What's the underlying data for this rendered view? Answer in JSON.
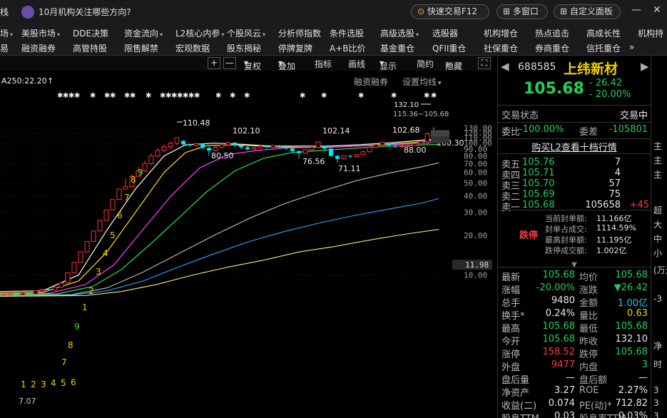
{
  "topbar": {
    "left_fragment": "栈",
    "news": "10月机构关注哪些方向?",
    "quick_trade": "快速交易F12",
    "multi_window": "多窗口",
    "custom_panel": "自定义面板",
    "minimize": "—",
    "close": "✕"
  },
  "menu_row1": [
    "场",
    "美股市场",
    "DDE决策",
    "资金流向",
    "L2核心内参",
    "个股风云",
    "分析师指数",
    "条件选股",
    "高级选股",
    "选股器",
    "机构增仓",
    "热点追击",
    "高成长性",
    "机构持"
  ],
  "menu_row2": [
    "易",
    "融资融券",
    "高管持股",
    "限售解禁",
    "宏观数据",
    "股东揭秘",
    "停牌复牌",
    "A+B比价",
    "基金重仓",
    "QFII重仓",
    "社保重仓",
    "券商重仓",
    "信托重仓",
    "»"
  ],
  "chart_toolbar": {
    "plus": "+",
    "minus": "—",
    "restore": "复权",
    "overlay": "叠加",
    "indicator": "指标",
    "draw": "画线",
    "display": "显示",
    "simple": "简约",
    "hide": "隐藏",
    "expand": "»"
  },
  "chart": {
    "ma_label": "A250:22.20",
    "margin_label": "融资融券",
    "set_ma": "设置均线",
    "y_ticks": [
      "130.00",
      "120.00",
      "110.00",
      "100.00",
      "90.00",
      "80.00",
      "70.00",
      "60.00",
      "50.00",
      "40.00",
      "30.00",
      "20.00",
      "10.00"
    ],
    "y_highlight": "11.98",
    "annotations": {
      "high": "132.10",
      "range": "115.36~105.68",
      "p110": "110.48",
      "p102a": "102.10",
      "p102b": "102.14",
      "p102c": "102.68",
      "p80": "80.50",
      "p76": "76.56",
      "p71": "71.11",
      "p88": "88.00",
      "p100": "100.30",
      "p7": "7.07"
    },
    "seq_a": [
      "1",
      "2",
      "3",
      "4",
      "5",
      "6"
    ],
    "seq_b": [
      "7",
      "8",
      "9",
      "1",
      "2",
      "3",
      "4",
      "5",
      "6",
      "7",
      "8",
      "9"
    ]
  },
  "stock": {
    "code": "688585",
    "name": "上纬新材",
    "price": "105.68",
    "change": "- 26.42",
    "pct": "- 20.00%",
    "status_label": "交易状态",
    "status_value": "交易中",
    "wb_label": "委比",
    "wb_value": "-100.00%",
    "wc_label": "委差",
    "wc_value": "-105801",
    "l2_link": "购买L2查看十档行情"
  },
  "asks": [
    {
      "label": "卖五",
      "price": "105.76",
      "vol": "7"
    },
    {
      "label": "卖四",
      "price": "105.71",
      "vol": "4"
    },
    {
      "label": "卖三",
      "price": "105.70",
      "vol": "57"
    },
    {
      "label": "卖二",
      "price": "105.69",
      "vol": "75"
    },
    {
      "label": "卖一",
      "price": "105.68",
      "vol": "105658",
      "delta": "+45"
    }
  ],
  "limit_down": {
    "tag": "跌停",
    "rows": [
      {
        "label": "当前封单额:",
        "value": "11.166亿"
      },
      {
        "label": "封单占成交:",
        "value": "1114.59%"
      },
      {
        "label": "最高封单额:",
        "value": "11.195亿"
      },
      {
        "label": "跌停成交额:",
        "value": "1.002亿"
      }
    ]
  },
  "stats": [
    {
      "l1": "最新",
      "v1": "105.68",
      "c1": "green",
      "l2": "均价",
      "v2": "105.68",
      "c2": "green"
    },
    {
      "l1": "涨幅",
      "v1": "-20.00%",
      "c1": "green",
      "l2": "涨跌",
      "v2": "▼26.42",
      "c2": "green"
    },
    {
      "l1": "总手",
      "v1": "9480",
      "c1": "white",
      "l2": "金额",
      "v2": "1.00亿",
      "c2": "cyan"
    },
    {
      "l1": "换手*",
      "v1": "0.24%",
      "c1": "white",
      "l2": "量比",
      "v2": "0.63",
      "c2": "yellow"
    },
    {
      "l1": "最高",
      "v1": "105.68",
      "c1": "green",
      "l2": "最低",
      "v2": "105.68",
      "c2": "green"
    },
    {
      "l1": "今开",
      "v1": "105.68",
      "c1": "green",
      "l2": "昨收",
      "v2": "132.10",
      "c2": "white"
    },
    {
      "l1": "涨停",
      "v1": "158.52",
      "c1": "red",
      "l2": "跌停",
      "v2": "105.68",
      "c2": "green"
    },
    {
      "l1": "外盘",
      "v1": "9477",
      "c1": "red",
      "l2": "内盘",
      "v2": "3",
      "c2": "green"
    },
    {
      "l1": "盘后量",
      "v1": "—",
      "c1": "white",
      "l2": "盘后额",
      "v2": "—",
      "c2": "white"
    },
    {
      "l1": "净资产",
      "v1": "3.27",
      "c1": "white",
      "l2": "ROE",
      "v2": "2.27%",
      "c2": "white"
    },
    {
      "l1": "收益(二)",
      "v1": "0.074",
      "c1": "white",
      "l2": "PE(动)*",
      "v2": "712.82",
      "c2": "white"
    },
    {
      "l1": "股息TTM",
      "v1": "0.03",
      "c1": "white",
      "l2": "股息率TTM",
      "v2": "0.03%",
      "c2": "white"
    }
  ],
  "far_panel": [
    "主",
    "主",
    "主",
    "超",
    "大",
    "中",
    "小",
    "(万元",
    "-3",
    "净",
    "时",
    "3",
    "3",
    "3"
  ]
}
